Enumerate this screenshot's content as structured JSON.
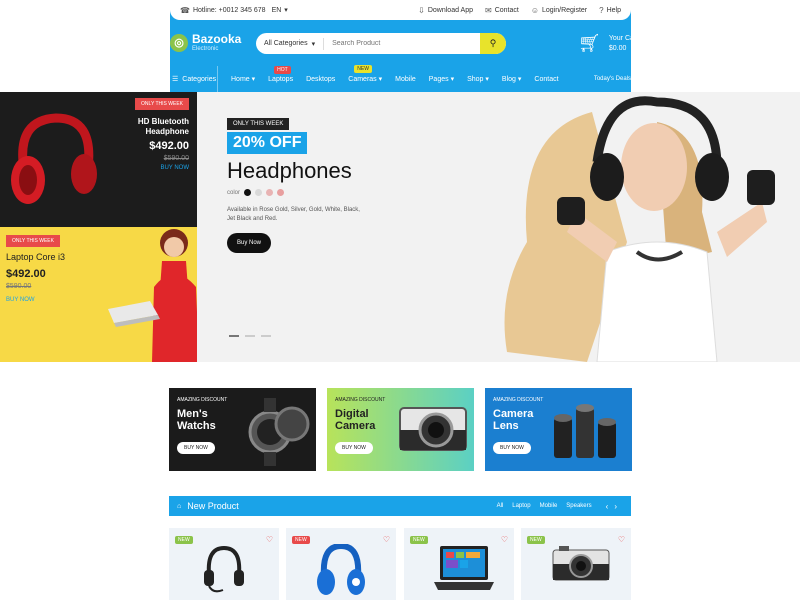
{
  "topbar": {
    "hotline": "Hotline: +0012 345 678",
    "language": "EN",
    "download": "Download App",
    "contact": "Contact",
    "login": "Login/Register",
    "help": "Help"
  },
  "logo": {
    "name": "Bazooka",
    "subtitle": "Electronic"
  },
  "search": {
    "category": "All Categories",
    "placeholder": "Search Product"
  },
  "cart": {
    "label": "Your Cart",
    "total": "$0.00"
  },
  "nav": {
    "categories": "Categories",
    "items": [
      "Home",
      "Laptops",
      "Desktops",
      "Cameras",
      "Mobile",
      "Pages",
      "Shop",
      "Blog",
      "Contact"
    ],
    "hot_badge": "HOT",
    "new_badge": "NEW",
    "right": "Today's Deals"
  },
  "banner_left": {
    "b1": {
      "tag": "ONLY THIS WEEK",
      "name": "HD Bluetooth Headphone",
      "price": "$492.00",
      "old_price": "$590.00",
      "buy": "BUY NOW"
    },
    "b2": {
      "tag": "ONLY THIS WEEK",
      "name": "Laptop Core i3",
      "price": "$492.00",
      "old_price": "$590.00",
      "buy": "BUY NOW"
    }
  },
  "hero": {
    "week_label": "ONLY THIS WEEK",
    "discount": "20% OFF",
    "title": "Headphones",
    "color_label": "color",
    "colors": [
      "#111111",
      "#d9d9d9",
      "#e8b3b3",
      "#e89f9f"
    ],
    "description": "Available in Rose Gold, Silver, Gold, White, Black, Jet Black and Red.",
    "button": "Buy Now"
  },
  "categories": [
    {
      "caption": "AMAZING DISCOUNT",
      "name_line1": "Men's",
      "name_line2": "Watchs",
      "button": "BUY NOW"
    },
    {
      "caption": "AMAZING DISCOUNT",
      "name_line1": "Digital",
      "name_line2": "Camera",
      "button": "BUY NOW"
    },
    {
      "caption": "AMAZING DISCOUNT",
      "name_line1": "Camera",
      "name_line2": "Lens",
      "button": "BUY NOW"
    }
  ],
  "new_product": {
    "title": "New Product",
    "filters": [
      "All",
      "Laptop",
      "Mobile",
      "Speakers"
    ]
  },
  "products": [
    {
      "badge": "NEW",
      "badge_color": "#8bc34a"
    },
    {
      "badge": "NEW",
      "badge_color": "#e84a4a"
    },
    {
      "badge": "NEW",
      "badge_color": "#8bc34a"
    },
    {
      "badge": "NEW",
      "badge_color": "#8bc34a"
    }
  ],
  "colors": {
    "primary": "#1aa3e8",
    "accent_green": "#8bc34a",
    "accent_yellow": "#e8e32b",
    "sale_red": "#e84a4a"
  }
}
